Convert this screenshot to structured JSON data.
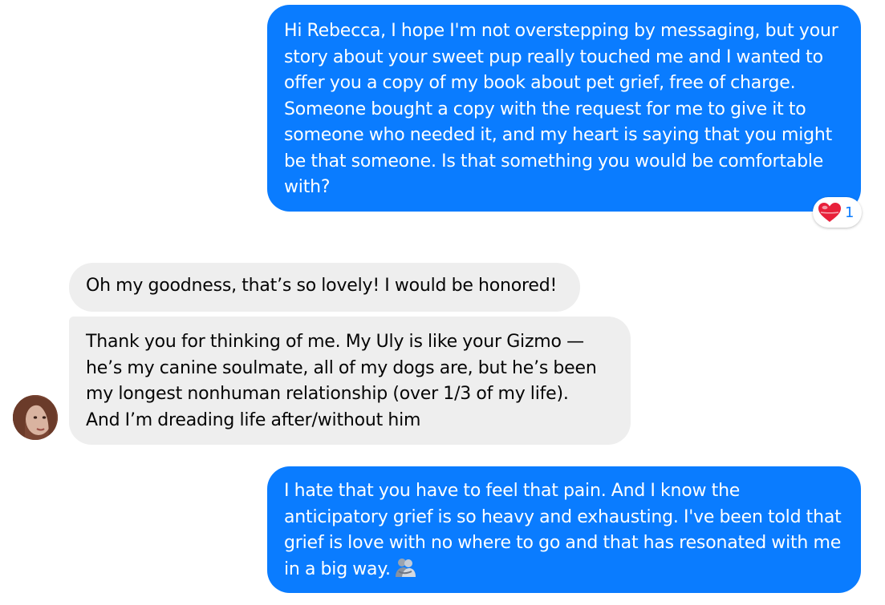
{
  "conversation": {
    "messages": [
      {
        "sender": "me",
        "text": "Hi Rebecca, I hope I'm not overstepping by messaging, but your\nstory about your sweet pup really touched me and I wanted to\noffer you a copy of my book about pet grief, free of charge.\nSomeone bought a copy with the request for me to give it to\nsomeone who needed it, and my heart is saying that you might\nbe that someone. Is that something you would be comfortable\nwith?",
        "reaction": {
          "icon": "heart-icon",
          "count": "1"
        }
      },
      {
        "sender": "them",
        "text": "Oh my goodness, that’s so lovely!  I would be honored!"
      },
      {
        "sender": "them",
        "text": "Thank you for thinking of me.  My Uly is like your Gizmo —\nhe’s my canine soulmate, all of my dogs are, but he’s been\nmy longest nonhuman relationship (over 1/3 of my life).\nAnd I’m dreading life after/without him"
      },
      {
        "sender": "me",
        "text": "I hate that you have to feel that pain. And I know the\nanticipatory grief is so heavy and exhausting. I've been told that\ngrief is love with no where to go and that has resonated with me\nin a big way.",
        "trailing_emoji": "people-hugging-emoji"
      }
    ]
  },
  "colors": {
    "sent_bubble": "#0a7cff",
    "received_bubble": "#eeeeee",
    "sent_text": "#ffffff",
    "received_text": "#050505",
    "reaction_heart": "#e8203a"
  }
}
